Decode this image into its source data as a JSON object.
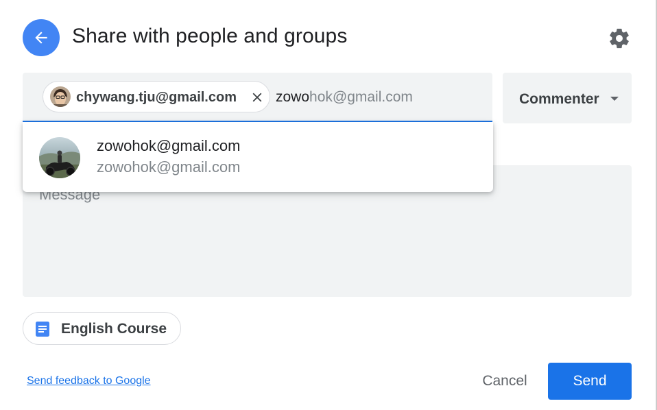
{
  "dialog": {
    "title": "Share with people and groups"
  },
  "recipients": {
    "chips": [
      {
        "email": "chywang.tju@gmail.com"
      }
    ],
    "typed_text": "zowo",
    "autocomplete_suffix": "hok@gmail.com"
  },
  "role": {
    "selected": "Commenter"
  },
  "suggestions": [
    {
      "name": "zowohok@gmail.com",
      "email": "zowohok@gmail.com"
    }
  ],
  "message": {
    "placeholder": "Message"
  },
  "document": {
    "title": "English Course"
  },
  "footer": {
    "feedback_link": "Send feedback to Google",
    "cancel_label": "Cancel",
    "send_label": "Send"
  },
  "colors": {
    "accent": "#1a73e8",
    "back_button": "#4285f4",
    "field_bg": "#f1f3f4",
    "doc_icon": "#4285f4"
  },
  "icons": {
    "back": "arrow-left-icon",
    "settings": "gear-icon",
    "remove_chip": "close-icon",
    "role_dropdown": "caret-down-icon",
    "document": "google-docs-icon"
  }
}
